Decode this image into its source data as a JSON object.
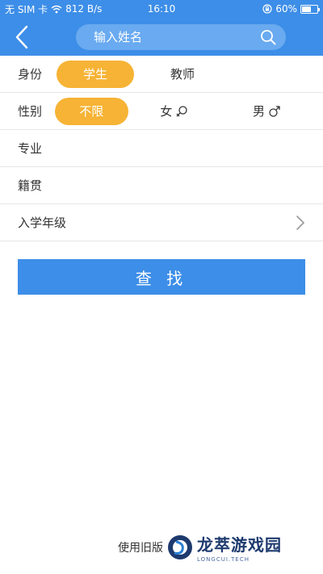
{
  "status_bar": {
    "carrier": "无 SIM 卡",
    "speed": "812 B/s",
    "time": "16:10",
    "battery": "60%",
    "battery_level": 0.6
  },
  "header": {
    "search_placeholder": "输入姓名"
  },
  "form": {
    "identity": {
      "label": "身份",
      "options": [
        "学生",
        "教师"
      ],
      "selected": "学生"
    },
    "gender": {
      "label": "性别",
      "options": [
        "不限",
        "女",
        "男"
      ],
      "selected": "不限"
    },
    "major": {
      "label": "专业"
    },
    "hometown": {
      "label": "籍贯"
    },
    "grade": {
      "label": "入学年级"
    }
  },
  "actions": {
    "find_label": "查 找",
    "old_version_label": "使用旧版"
  },
  "watermark": {
    "name": "龙萃游戏园",
    "sub": "LONGCUI.TECH"
  },
  "colors": {
    "primary": "#3d8ee8",
    "accent": "#f6b335"
  }
}
